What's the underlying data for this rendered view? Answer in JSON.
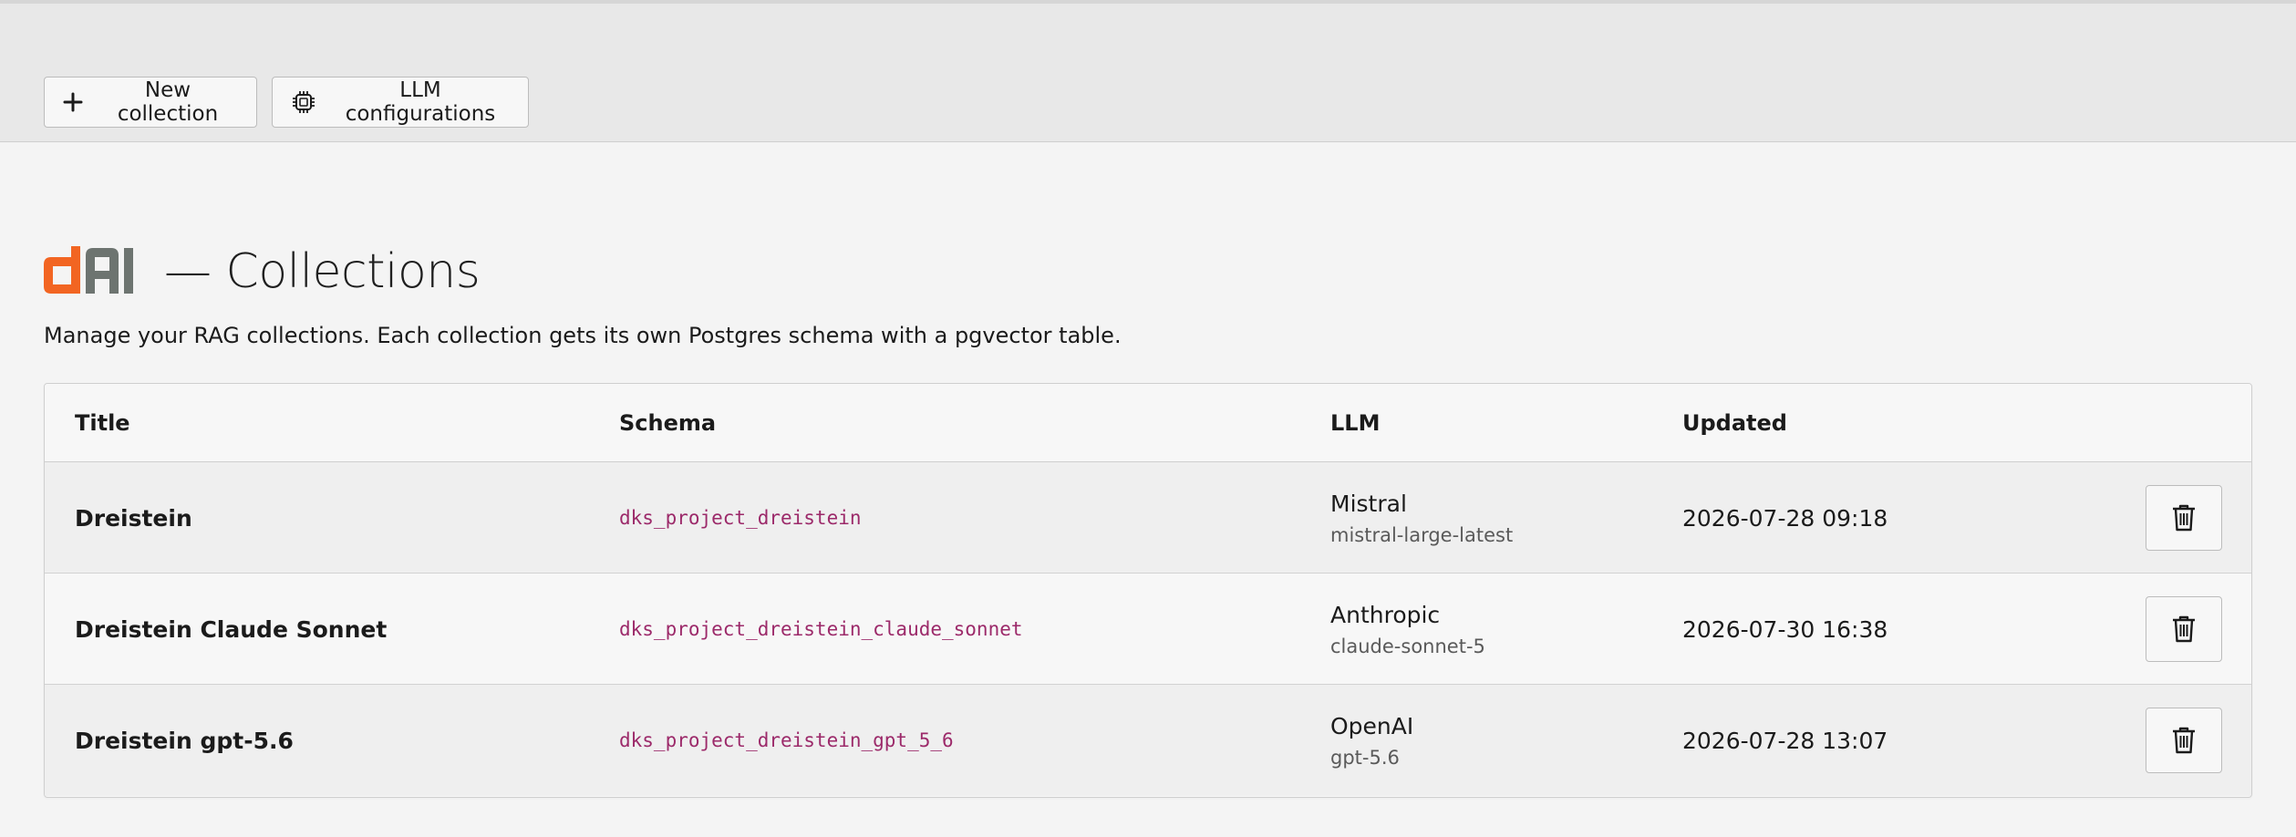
{
  "toolbar": {
    "new_collection_label": "New collection",
    "llm_configurations_label": "LLM configurations"
  },
  "header": {
    "logo_text": "dAI",
    "title": "— Collections",
    "description": "Manage your RAG collections. Each collection gets its own Postgres schema with a pgvector table."
  },
  "table": {
    "columns": [
      "Title",
      "Schema",
      "LLM",
      "Updated"
    ],
    "rows": [
      {
        "title": "Dreistein",
        "schema": "dks_project_dreistein",
        "provider": "Mistral",
        "model": "mistral-large-latest",
        "updated": "2026-07-28 09:18"
      },
      {
        "title": "Dreistein Claude Sonnet",
        "schema": "dks_project_dreistein_claude_sonnet",
        "provider": "Anthropic",
        "model": "claude-sonnet-5",
        "updated": "2026-07-30 16:38"
      },
      {
        "title": "Dreistein gpt-5.6",
        "schema": "dks_project_dreistein_gpt_5_6",
        "provider": "OpenAI",
        "model": "gpt-5.6",
        "updated": "2026-07-28 13:07"
      }
    ]
  },
  "icons": {
    "new": "plus-icon",
    "llm": "chip-icon",
    "delete": "trash-icon"
  },
  "colors": {
    "logo_orange": "#f26522",
    "logo_gray": "#6d7470",
    "schema_text": "#9c2a6a"
  }
}
